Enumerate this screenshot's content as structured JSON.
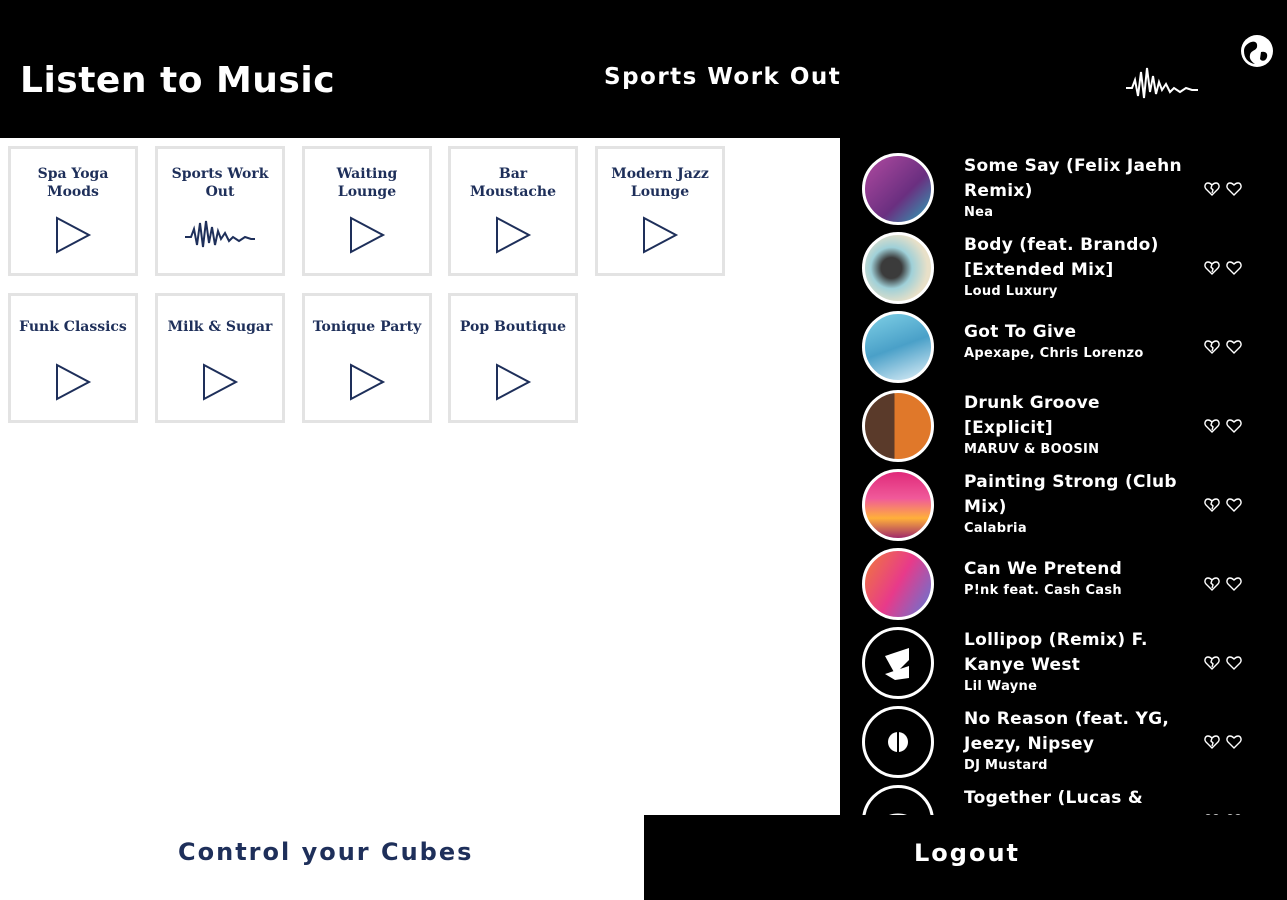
{
  "header": {
    "title": "Listen to Music",
    "now_playing": "Sports Work Out",
    "wave_icon": "waveform-icon",
    "globe_icon": "globe-icon"
  },
  "playlists": [
    {
      "label": "Spa Yoga Moods",
      "icon": "play-icon"
    },
    {
      "label": "Sports Work Out",
      "icon": "waveform-icon",
      "active": true
    },
    {
      "label": "Waiting Lounge",
      "icon": "play-icon"
    },
    {
      "label": "Bar Moustache",
      "icon": "play-icon"
    },
    {
      "label": "Modern Jazz Lounge",
      "icon": "play-icon"
    },
    {
      "label": "Funk Classics",
      "icon": "play-icon"
    },
    {
      "label": "Milk & Sugar",
      "icon": "play-icon"
    },
    {
      "label": "Tonique Party",
      "icon": "play-icon"
    },
    {
      "label": "Pop Boutique",
      "icon": "play-icon"
    }
  ],
  "tracks": [
    {
      "title": "Some Say (Felix Jaehn Remix)",
      "artist": "Nea"
    },
    {
      "title": "Body (feat. Brando) [Extended Mix]",
      "artist": "Loud Luxury"
    },
    {
      "title": "Got To Give",
      "artist": "Apexape, Chris Lorenzo"
    },
    {
      "title": "Drunk Groove [Explicit]",
      "artist": "MARUV & BOOSIN"
    },
    {
      "title": "Painting Strong (Club Mix)",
      "artist": "Calabria"
    },
    {
      "title": "Can We Pretend",
      "artist": "P!nk feat. Cash Cash"
    },
    {
      "title": "Lollipop (Remix) F. Kanye West",
      "artist": "Lil Wayne"
    },
    {
      "title": "No Reason (feat. YG, Jeezy, Nipsey",
      "artist": "DJ Mustard"
    },
    {
      "title": "Together (Lucas & Steve Remix)",
      "artist": ""
    }
  ],
  "track_icons": {
    "dislike": "broken-heart-icon",
    "like": "heart-icon"
  },
  "footer": {
    "control_label": "Control your Cubes",
    "logout_label": "Logout"
  },
  "colors": {
    "accent": "#1e2f5a",
    "header_bg": "#000000",
    "tile_border": "#e3e3e3"
  }
}
